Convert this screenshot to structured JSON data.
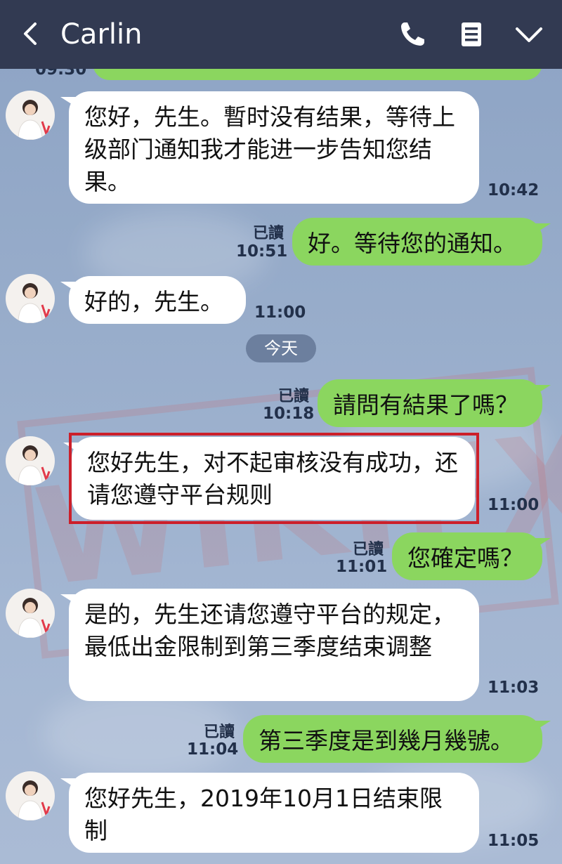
{
  "header": {
    "title": "Carlin",
    "back_icon": "chevron-left-icon",
    "call_icon": "phone-icon",
    "menu_icon": "notes-icon",
    "expand_icon": "chevron-down-icon"
  },
  "partial_top": {
    "time": "09:30"
  },
  "messages": [
    {
      "direction": "in",
      "text": "您好，先生。暫时没有结果，等待上级部门通知我才能进一步告知您结果。",
      "time": "10:42"
    },
    {
      "direction": "out",
      "text": "好。等待您的通知。",
      "read": "已讀",
      "time": "10:51"
    },
    {
      "direction": "in",
      "text": "好的，先生。",
      "time": "11:00"
    },
    {
      "direction": "out",
      "text": "請問有結果了嗎？",
      "read": "已讀",
      "time": "10:18"
    },
    {
      "direction": "in",
      "text": "您好先生，对不起审核没有成功，还请您遵守平台规则",
      "time": "11:00",
      "highlighted": true
    },
    {
      "direction": "out",
      "text": "您確定嗎？",
      "read": "已讀",
      "time": "11:01"
    },
    {
      "direction": "in",
      "text": "是的，先生还请您遵守平台的规定，最低出金限制到第三季度结束调整",
      "time": "11:03"
    },
    {
      "direction": "out",
      "text": "第三季度是到幾月幾號。",
      "read": "已讀",
      "time": "11:04"
    },
    {
      "direction": "in",
      "text": "您好先生，2019年10月1日结束限制",
      "time": "11:05"
    }
  ],
  "date_divider": "今天",
  "watermark": "WIKIFX",
  "colors": {
    "header_bg": "#323a52",
    "out_bubble": "#8bd65f",
    "in_bubble": "#ffffff",
    "highlight_border": "#cc1f2a",
    "chat_bg": "#97acca"
  }
}
